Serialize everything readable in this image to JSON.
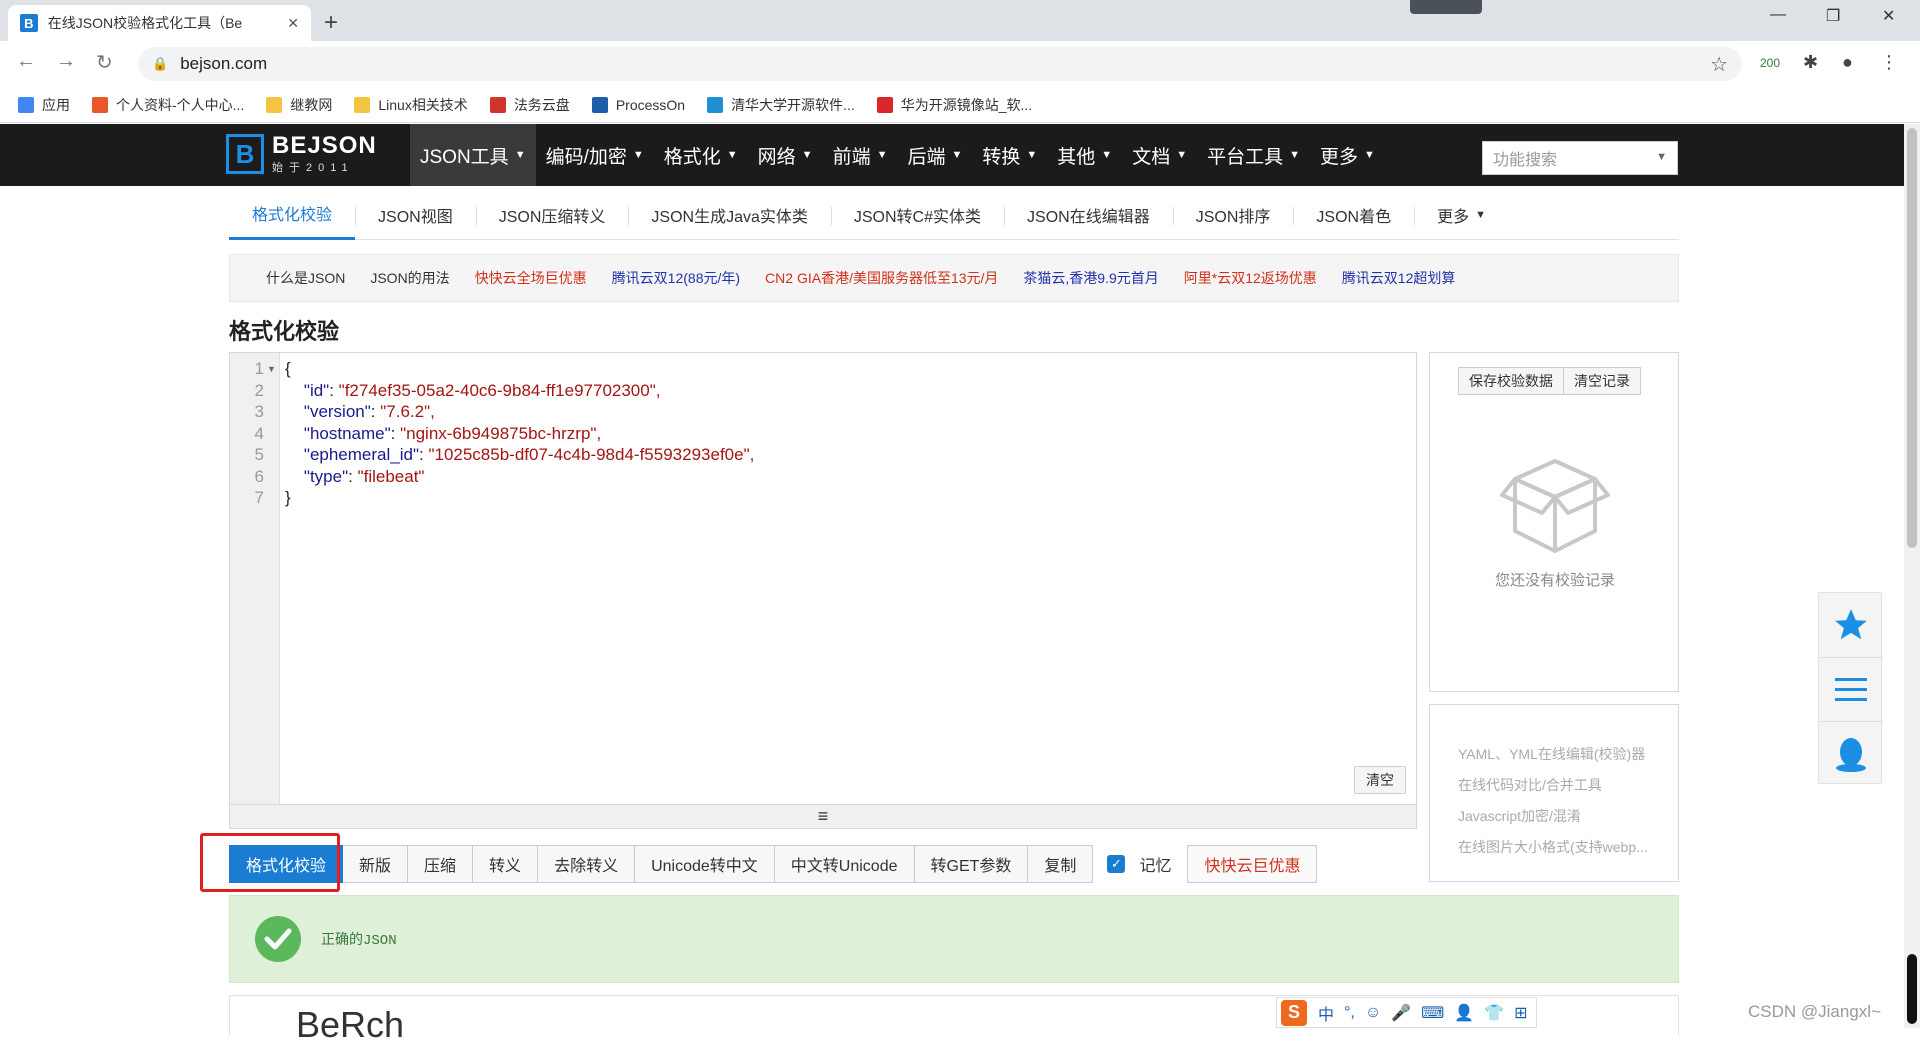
{
  "browser": {
    "tab_title": "在线JSON校验格式化工具（Be",
    "url": "bejson.com",
    "extension_badge": "200"
  },
  "bookmarks": [
    {
      "label": "应用",
      "color": "#4285f4"
    },
    {
      "label": "个人资料-个人中心...",
      "color": "#e8582a"
    },
    {
      "label": "继教网",
      "color": "#f4c542"
    },
    {
      "label": "Linux相关技术",
      "color": "#f4c542"
    },
    {
      "label": "法务云盘",
      "color": "#d0342c"
    },
    {
      "label": "ProcessOn",
      "color": "#1d5fa8"
    },
    {
      "label": "清华大学开源软件...",
      "color": "#1f8fd6"
    },
    {
      "label": "华为开源镜像站_软...",
      "color": "#d9262c"
    }
  ],
  "site": {
    "logo_main": "BEJSON",
    "logo_sub": "始于2011",
    "menu": [
      {
        "label": "JSON工具",
        "active": true
      },
      {
        "label": "编码/加密"
      },
      {
        "label": "格式化"
      },
      {
        "label": "网络"
      },
      {
        "label": "前端"
      },
      {
        "label": "后端"
      },
      {
        "label": "转换"
      },
      {
        "label": "其他"
      },
      {
        "label": "文档"
      },
      {
        "label": "平台工具"
      },
      {
        "label": "更多"
      }
    ],
    "search_placeholder": "功能搜索"
  },
  "subtabs": [
    "格式化校验",
    "JSON视图",
    "JSON压缩转义",
    "JSON生成Java实体类",
    "JSON转C#实体类",
    "JSON在线编辑器",
    "JSON排序",
    "JSON着色",
    "更多"
  ],
  "promo_links": [
    {
      "label": "什么是JSON",
      "color": "#333333"
    },
    {
      "label": "JSON的用法",
      "color": "#333333"
    },
    {
      "label": "快快云全场巨优惠",
      "color": "#d0311b"
    },
    {
      "label": "腾讯云双12(88元/年)",
      "color": "#2233aa"
    },
    {
      "label": "CN2 GIA香港/美国服务器低至13元/月",
      "color": "#d0311b"
    },
    {
      "label": "茶猫云,香港9.9元首月",
      "color": "#2233aa"
    },
    {
      "label": "阿里*云双12返场优惠",
      "color": "#d0311b"
    },
    {
      "label": "腾讯云双12超划算",
      "color": "#2233aa"
    }
  ],
  "page_title": "格式化校验",
  "editor": {
    "line_numbers": [
      "1",
      "2",
      "3",
      "4",
      "5",
      "6",
      "7"
    ],
    "lines": [
      {
        "indent": "",
        "key": "",
        "value": "{"
      },
      {
        "indent": "    ",
        "key": "\"id\"",
        "value": "\"f274ef35-05a2-40c6-9b84-ff1e97702300\","
      },
      {
        "indent": "    ",
        "key": "\"version\"",
        "value": "\"7.6.2\","
      },
      {
        "indent": "    ",
        "key": "\"hostname\"",
        "value": "\"nginx-6b949875bc-hrzrp\","
      },
      {
        "indent": "    ",
        "key": "\"ephemeral_id\"",
        "value": "\"1025c85b-df07-4c4b-98d4-f5593293ef0e\","
      },
      {
        "indent": "    ",
        "key": "\"type\"",
        "value": "\"filebeat\""
      },
      {
        "indent": "",
        "key": "",
        "value": "}"
      }
    ],
    "clear_label": "清空",
    "resize_glyph": "≡"
  },
  "history": {
    "save_label": "保存校验数据",
    "clear_label": "清空记录",
    "empty_text": "您还没有校验记录"
  },
  "side_links": [
    "YAML、YML在线编辑(校验)器",
    "在线代码对比/合并工具",
    "Javascript加密/混淆",
    "在线图片大小格式(支持webp..."
  ],
  "actions": [
    "格式化校验",
    "新版",
    "压缩",
    "转义",
    "去除转义",
    "Unicode转中文",
    "中文转Unicode",
    "转GET参数",
    "复制"
  ],
  "memory_label": "记忆",
  "promo_button": "快快云巨优惠",
  "result_text": "正确的JSON",
  "bottom_card_text": "BeRch",
  "ime": {
    "logo": "S",
    "items": [
      "中",
      "°,",
      "☺",
      "🎤",
      "⌨",
      "👤",
      "👕",
      "⊞"
    ]
  },
  "watermark": "CSDN @Jiangxl~"
}
